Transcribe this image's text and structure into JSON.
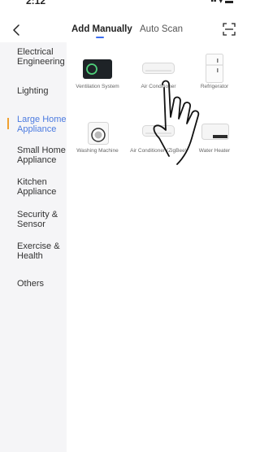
{
  "status": {
    "time": "2:12"
  },
  "header": {
    "tabs": [
      {
        "label": "Add Manually",
        "active": true
      },
      {
        "label": "Auto Scan",
        "active": false
      }
    ],
    "accent_color": "#3b6df0"
  },
  "sidebar": {
    "items": [
      {
        "label": "Electrical Engineering"
      },
      {
        "label": "Lighting"
      },
      {
        "label": "Large Home Appliance",
        "active": true
      },
      {
        "label": "Small Home Appliance"
      },
      {
        "label": "Kitchen Appliance"
      },
      {
        "label": "Security & Sensor"
      },
      {
        "label": "Exercise & Health"
      },
      {
        "label": "Others"
      }
    ],
    "active_color": "#4c7be0",
    "indicator_color": "#f0a030"
  },
  "devices": [
    {
      "label": "Ventilation System"
    },
    {
      "label": "Air Conditioner"
    },
    {
      "label": "Refrigerator"
    },
    {
      "label": "Washing Machine"
    },
    {
      "label": "Air Conditioner (ZigBee)"
    },
    {
      "label": "Water Heater"
    }
  ]
}
